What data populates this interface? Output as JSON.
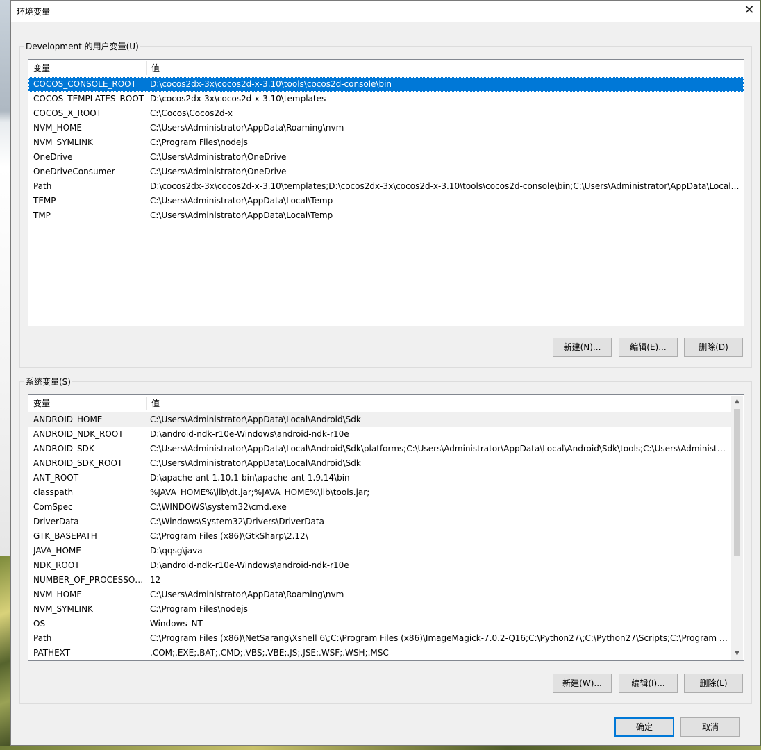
{
  "window": {
    "title": "环境变量",
    "close_glyph": "✕"
  },
  "user_vars": {
    "group_label": "Development 的用户变量(U)",
    "col_name": "变量",
    "col_value": "值",
    "rows": [
      {
        "name": "COCOS_CONSOLE_ROOT",
        "value": "D:\\cocos2dx-3x\\cocos2d-x-3.10\\tools\\cocos2d-console\\bin",
        "selected": true
      },
      {
        "name": "COCOS_TEMPLATES_ROOT",
        "value": "D:\\cocos2dx-3x\\cocos2d-x-3.10\\templates"
      },
      {
        "name": "COCOS_X_ROOT",
        "value": "C:\\Cocos\\Cocos2d-x"
      },
      {
        "name": "NVM_HOME",
        "value": "C:\\Users\\Administrator\\AppData\\Roaming\\nvm"
      },
      {
        "name": "NVM_SYMLINK",
        "value": "C:\\Program Files\\nodejs"
      },
      {
        "name": "OneDrive",
        "value": "C:\\Users\\Administrator\\OneDrive"
      },
      {
        "name": "OneDriveConsumer",
        "value": "C:\\Users\\Administrator\\OneDrive"
      },
      {
        "name": "Path",
        "value": "D:\\cocos2dx-3x\\cocos2d-x-3.10\\templates;D:\\cocos2dx-3x\\cocos2d-x-3.10\\tools\\cocos2d-console\\bin;C:\\Users\\Administrator\\AppData\\Local\\M..."
      },
      {
        "name": "TEMP",
        "value": "C:\\Users\\Administrator\\AppData\\Local\\Temp"
      },
      {
        "name": "TMP",
        "value": "C:\\Users\\Administrator\\AppData\\Local\\Temp"
      }
    ],
    "new_label": "新建(N)...",
    "edit_label": "编辑(E)...",
    "delete_label": "删除(D)"
  },
  "system_vars": {
    "group_label": "系统变量(S)",
    "col_name": "变量",
    "col_value": "值",
    "rows": [
      {
        "name": "ANDROID_HOME",
        "value": "C:\\Users\\Administrator\\AppData\\Local\\Android\\Sdk",
        "hover": true
      },
      {
        "name": "ANDROID_NDK_ROOT",
        "value": "D:\\android-ndk-r10e-Windows\\android-ndk-r10e"
      },
      {
        "name": "ANDROID_SDK",
        "value": "C:\\Users\\Administrator\\AppData\\Local\\Android\\Sdk\\platforms;C:\\Users\\Administrator\\AppData\\Local\\Android\\Sdk\\tools;C:\\Users\\Administr..."
      },
      {
        "name": "ANDROID_SDK_ROOT",
        "value": "C:\\Users\\Administrator\\AppData\\Local\\Android\\Sdk"
      },
      {
        "name": "ANT_ROOT",
        "value": "D:\\apache-ant-1.10.1-bin\\apache-ant-1.9.14\\bin"
      },
      {
        "name": "classpath",
        "value": "%JAVA_HOME%\\lib\\dt.jar;%JAVA_HOME%\\lib\\tools.jar;"
      },
      {
        "name": "ComSpec",
        "value": "C:\\WINDOWS\\system32\\cmd.exe"
      },
      {
        "name": "DriverData",
        "value": "C:\\Windows\\System32\\Drivers\\DriverData"
      },
      {
        "name": "GTK_BASEPATH",
        "value": "C:\\Program Files (x86)\\GtkSharp\\2.12\\"
      },
      {
        "name": "JAVA_HOME",
        "value": "D:\\qqsg\\java"
      },
      {
        "name": "NDK_ROOT",
        "value": "D:\\android-ndk-r10e-Windows\\android-ndk-r10e"
      },
      {
        "name": "NUMBER_OF_PROCESSORS",
        "value": "12"
      },
      {
        "name": "NVM_HOME",
        "value": "C:\\Users\\Administrator\\AppData\\Roaming\\nvm"
      },
      {
        "name": "NVM_SYMLINK",
        "value": "C:\\Program Files\\nodejs"
      },
      {
        "name": "OS",
        "value": "Windows_NT"
      },
      {
        "name": "Path",
        "value": "C:\\Program Files (x86)\\NetSarang\\Xshell 6\\;C:\\Program Files (x86)\\ImageMagick-7.0.2-Q16;C:\\Python27\\;C:\\Python27\\Scripts;C:\\Program Files..."
      },
      {
        "name": "PATHEXT",
        "value": ".COM;.EXE;.BAT;.CMD;.VBS;.VBE;.JS;.JSE;.WSF;.WSH;.MSC"
      }
    ],
    "new_label": "新建(W)...",
    "edit_label": "编辑(I)...",
    "delete_label": "删除(L)",
    "scroll_up_glyph": "▲",
    "scroll_down_glyph": "▼"
  },
  "footer": {
    "ok_label": "确定",
    "cancel_label": "取消"
  }
}
